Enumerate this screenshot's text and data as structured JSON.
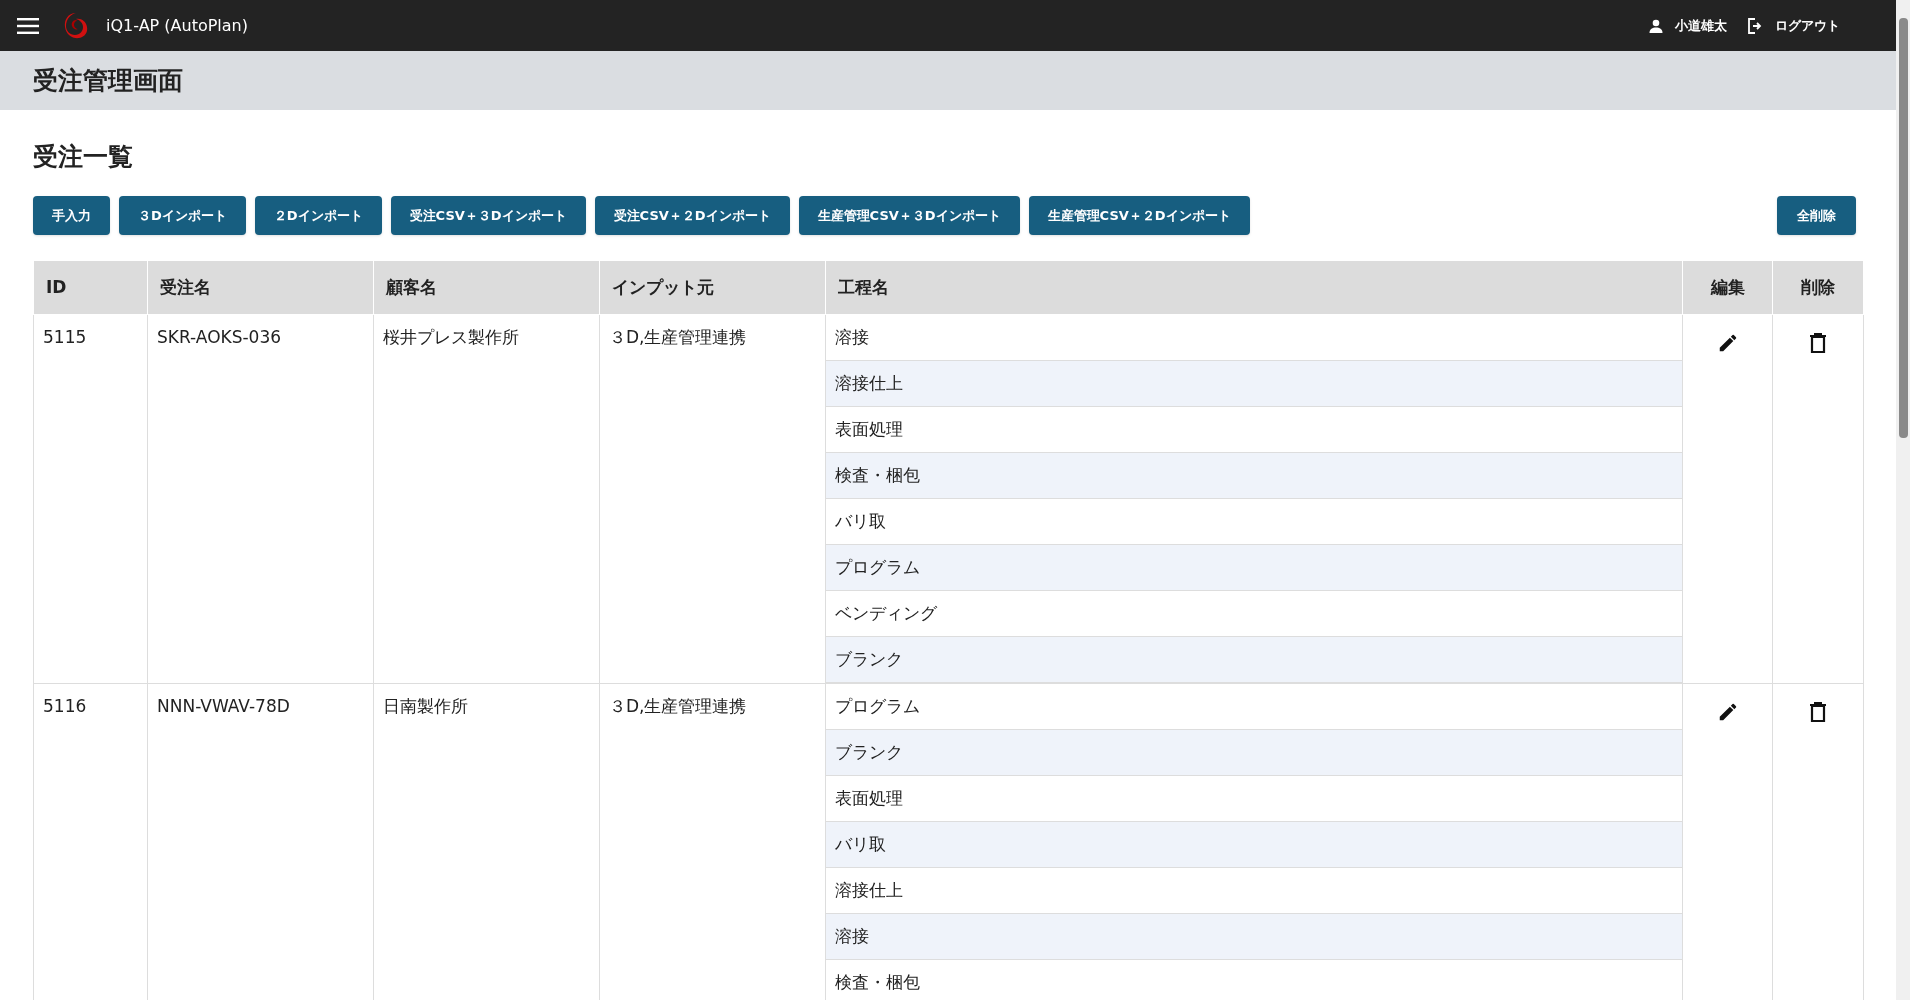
{
  "app_bar": {
    "title": "iQ1-AP (AutoPlan)",
    "user": "小道雄太",
    "logout": "ログアウト"
  },
  "page_title": "受注管理画面",
  "section_title": "受注一覧",
  "buttons": [
    {
      "label": "手入力"
    },
    {
      "label": "３Dインポート"
    },
    {
      "label": "２Dインポート"
    },
    {
      "label": "受注CSV＋３Dインポート"
    },
    {
      "label": "受注CSV＋２Dインポート"
    },
    {
      "label": "生産管理CSV＋３Dインポート"
    },
    {
      "label": "生産管理CSV＋２Dインポート"
    }
  ],
  "delete_all": "全削除",
  "table": {
    "columns": [
      "ID",
      "受注名",
      "顧客名",
      "インプット元",
      "工程名",
      "編集",
      "削除"
    ],
    "rows": [
      {
        "id": "5115",
        "order_name": "SKR-AOKS-036",
        "customer": "桜井プレス製作所",
        "source": "３D,生産管理連携",
        "processes": [
          "溶接",
          "溶接仕上",
          "表面処理",
          "検査・梱包",
          "バリ取",
          "プログラム",
          "ベンディング",
          "ブランク"
        ]
      },
      {
        "id": "5116",
        "order_name": "NNN-VWAV-78D",
        "customer": "日南製作所",
        "source": "３D,生産管理連携",
        "processes": [
          "プログラム",
          "ブランク",
          "表面処理",
          "バリ取",
          "溶接仕上",
          "溶接",
          "検査・梱包"
        ]
      }
    ]
  }
}
